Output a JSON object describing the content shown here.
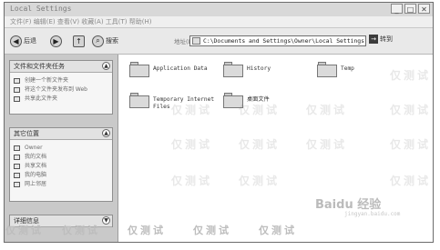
{
  "window": {
    "title": "Local Settings",
    "buttons": [
      "_",
      "□",
      "✕"
    ]
  },
  "menubar": {
    "text": "文件(F) 编辑(E) 查看(V) 收藏(A) 工具(T) 帮助(H)"
  },
  "toolbar": {
    "back_label": "后退",
    "forward_icon": "forward-arrow",
    "up_icon": "up-arrow",
    "search_label": "搜索",
    "address_label": "地址(D)",
    "address_value": "C:\\Documents and Settings\\Owner\\Local Settings",
    "go_label": "转到"
  },
  "sidebar": {
    "tasks_panel": {
      "title": "文件和文件夹任务",
      "items": [
        "创建一个新文件夹",
        "将这个文件夹发布到 Web",
        "共享此文件夹"
      ]
    },
    "places_panel": {
      "title": "其它位置",
      "items": [
        "Owner",
        "我的文档",
        "共享文档",
        "我的电脑",
        "网上邻居"
      ]
    },
    "details_panel": {
      "title": "详细信息"
    }
  },
  "folders": [
    {
      "label": "Application Data"
    },
    {
      "label": "History"
    },
    {
      "label": "Temp"
    },
    {
      "label": "Temporary Internet Files"
    },
    {
      "label": "桌面文件"
    }
  ],
  "watermark": {
    "text": "仅测试",
    "brand": "Baidu 经验",
    "brand_url": "jingyan.baidu.com"
  }
}
